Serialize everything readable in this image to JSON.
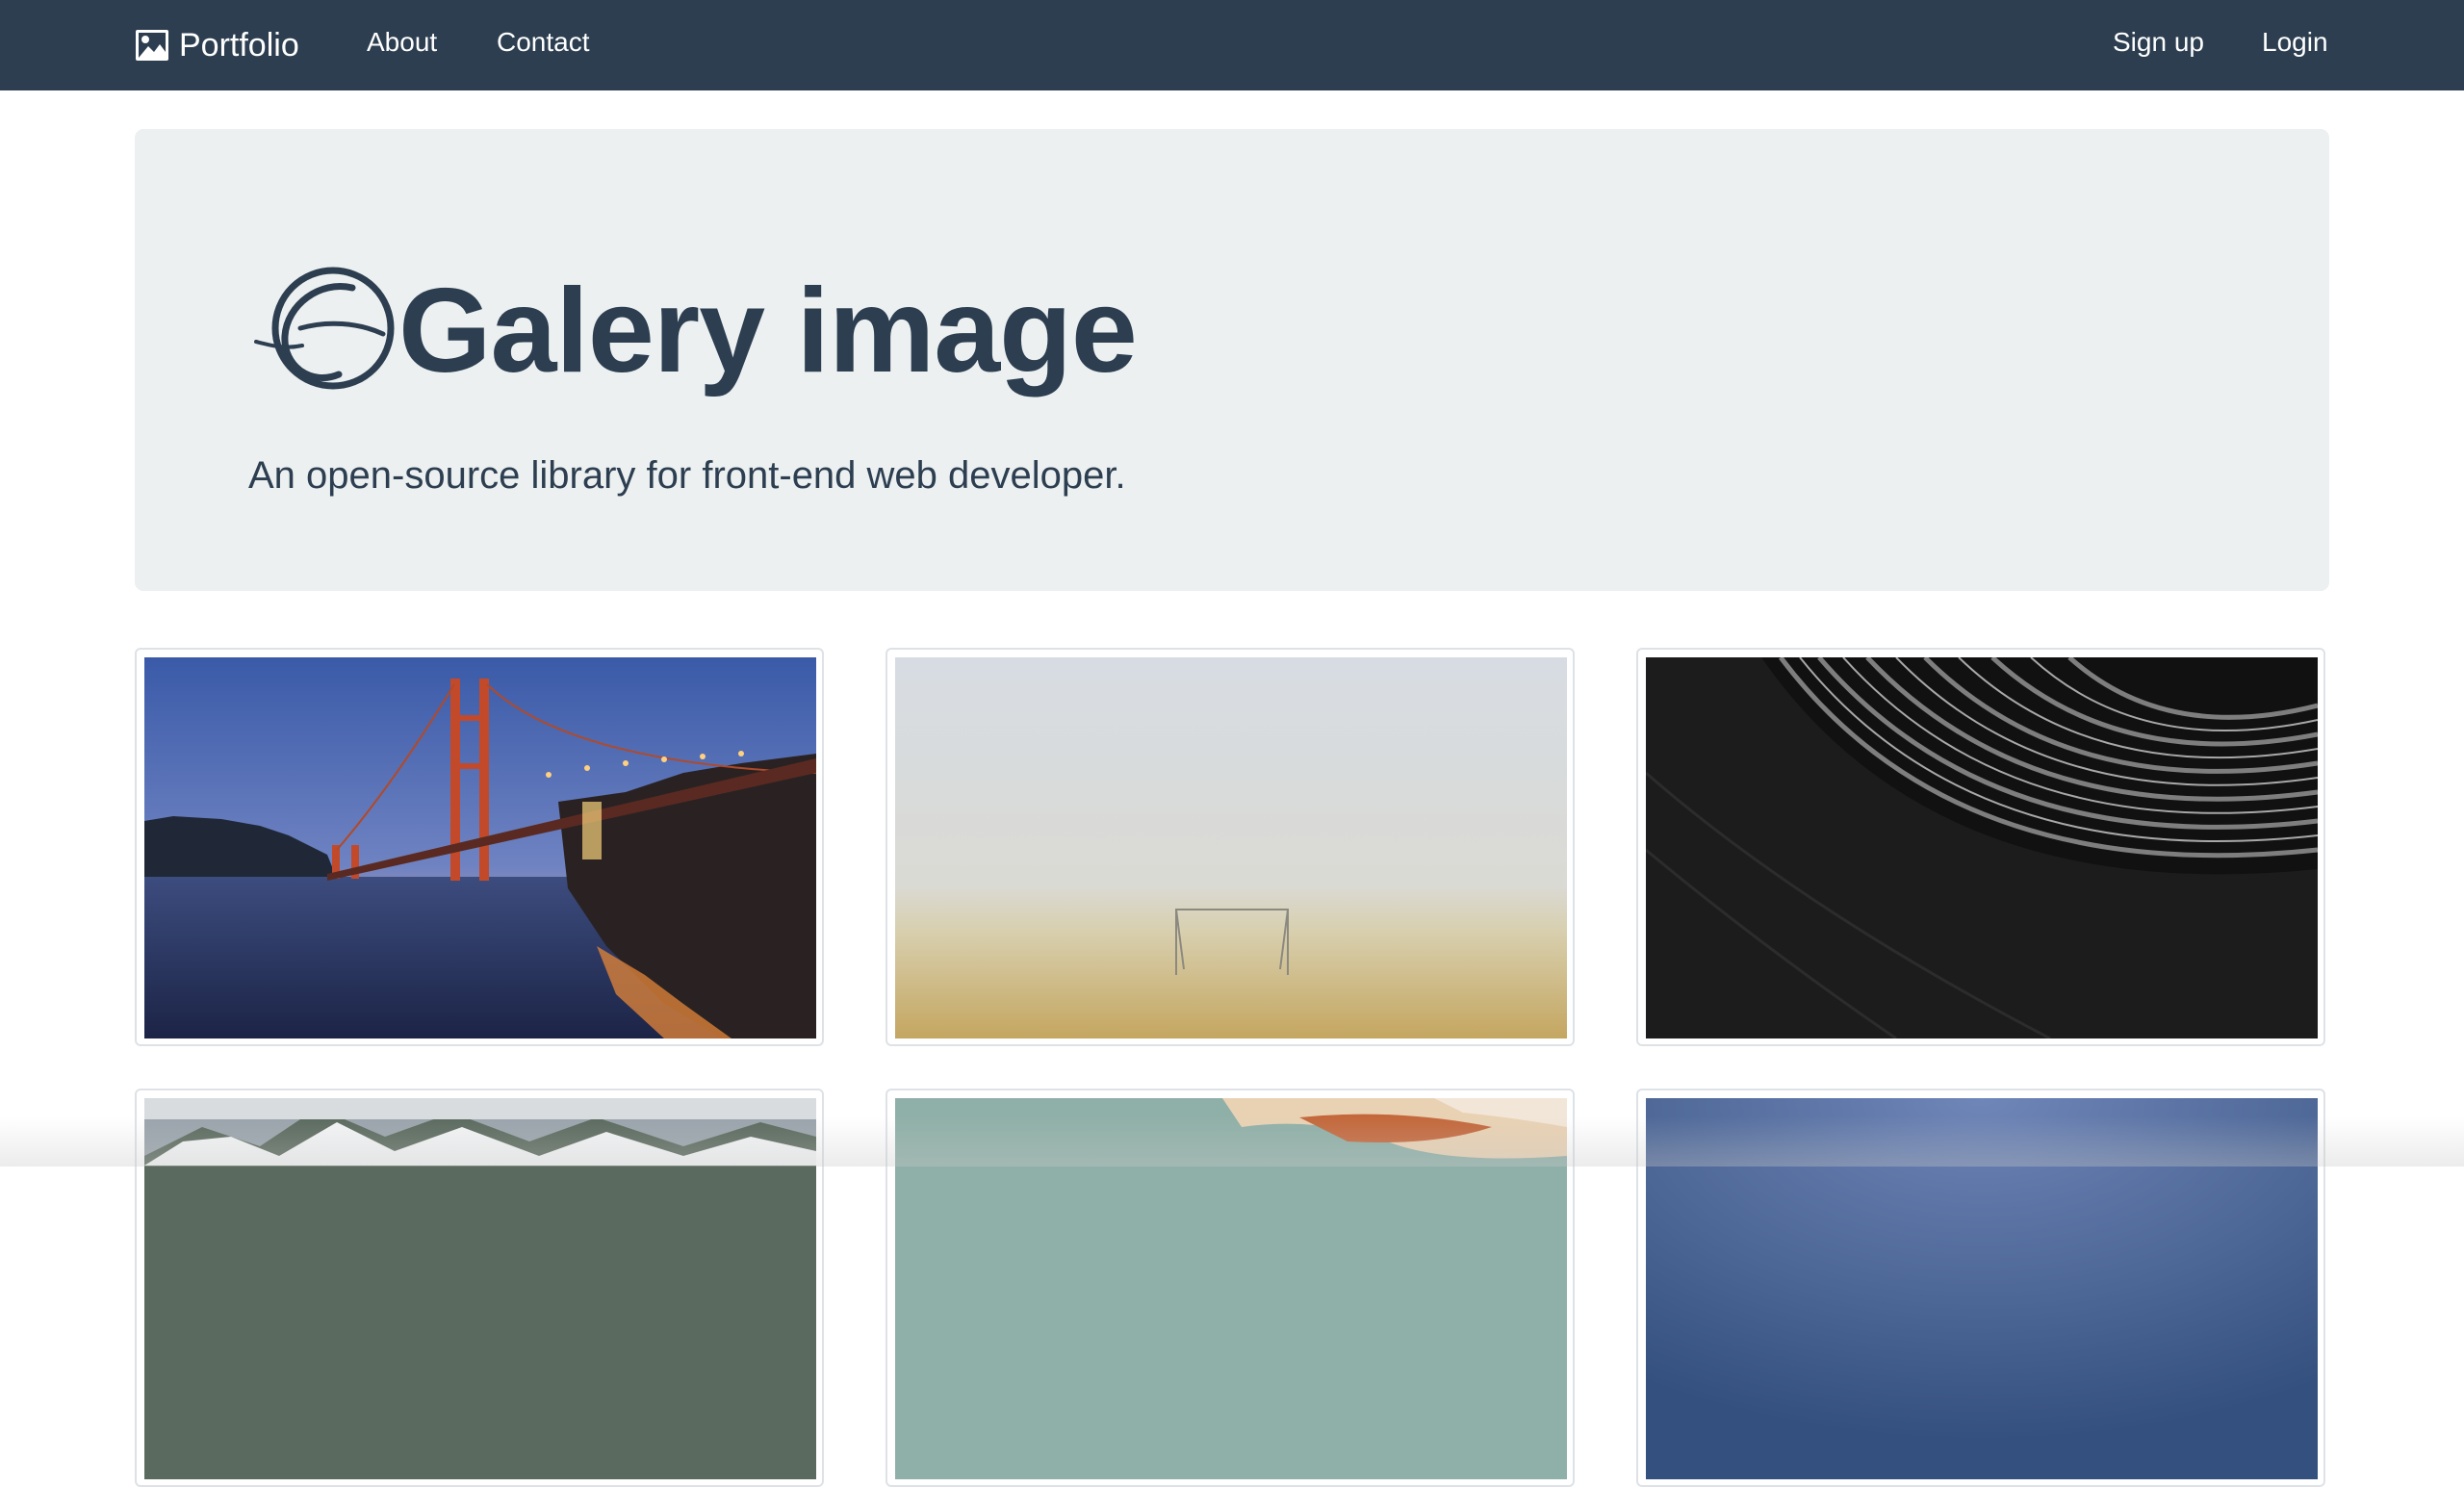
{
  "navbar": {
    "brand_label": "Portfolio",
    "brand_icon": "image-icon",
    "left_links": [
      "About",
      "Contact"
    ],
    "right_links": [
      "Sign up",
      "Login"
    ],
    "background_color": "#2c3e50"
  },
  "hero": {
    "title": "Galery image",
    "lead": "An open-source library for front-end web developer.",
    "logo_icon": "circle-swoosh-logo",
    "background_color": "#ecf0f1",
    "text_color": "#2c3e50"
  },
  "gallery": {
    "items": [
      {
        "subject": "golden-gate-bridge-at-dusk"
      },
      {
        "subject": "foggy-field-with-soccer-goal"
      },
      {
        "subject": "black-white-architecture-pattern"
      },
      {
        "subject": "snowy-mountains"
      },
      {
        "subject": "sunset-clouds"
      },
      {
        "subject": "blue-sky"
      }
    ]
  }
}
